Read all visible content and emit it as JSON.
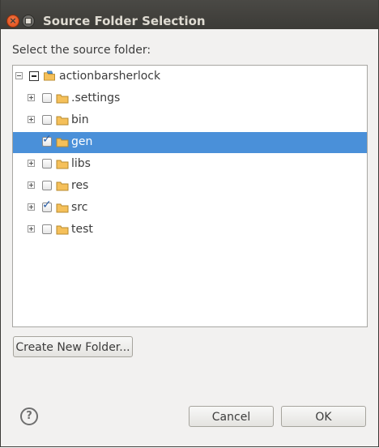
{
  "window": {
    "title": "Source Folder Selection"
  },
  "dialog": {
    "prompt": "Select the source folder:"
  },
  "tree": {
    "root": {
      "label": "actionbarsherlock",
      "icon": "project-folder-icon",
      "expanded": true
    },
    "items": [
      {
        "label": ".settings",
        "checked": false,
        "selected": false
      },
      {
        "label": "bin",
        "checked": false,
        "selected": false
      },
      {
        "label": "gen",
        "checked": true,
        "selected": true
      },
      {
        "label": "libs",
        "checked": false,
        "selected": false
      },
      {
        "label": "res",
        "checked": false,
        "selected": false
      },
      {
        "label": "src",
        "checked": true,
        "selected": false
      },
      {
        "label": "test",
        "checked": false,
        "selected": false
      }
    ]
  },
  "buttons": {
    "create_folder": "Create New Folder...",
    "help": "?",
    "cancel": "Cancel",
    "ok": "OK"
  },
  "colors": {
    "selection": "#4a90d9",
    "titlebar": "#3c3b37",
    "close_button": "#df4a16",
    "folder": "#f5c05a"
  }
}
